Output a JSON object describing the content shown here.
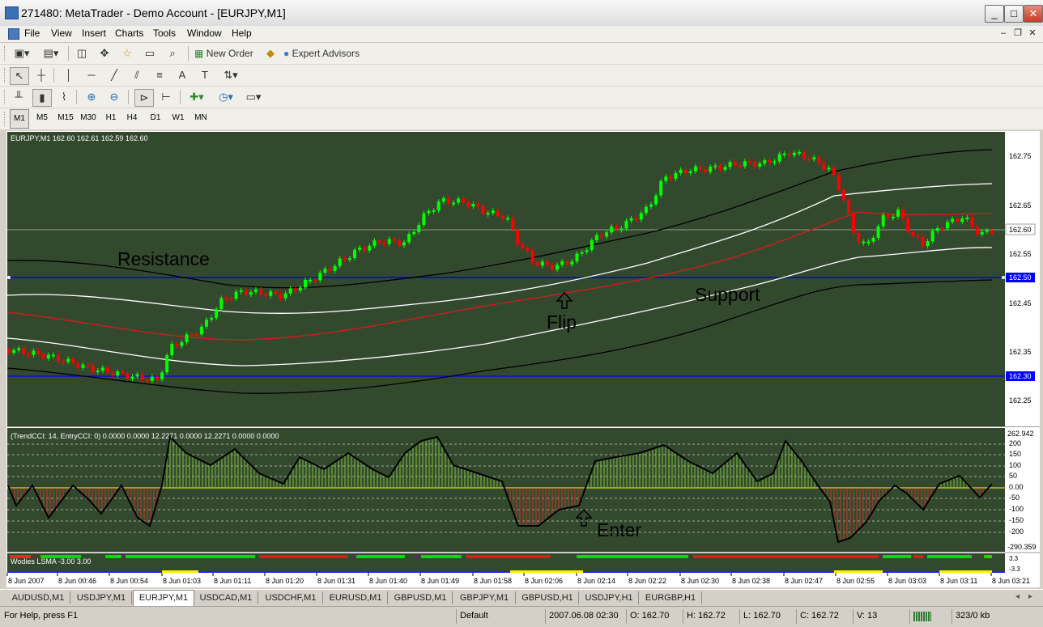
{
  "window": {
    "title": "271480: MetaTrader - Demo Account - [EURJPY,M1]"
  },
  "menu": [
    "File",
    "View",
    "Insert",
    "Charts",
    "Tools",
    "Window",
    "Help"
  ],
  "toolbar": {
    "new_order": "New Order",
    "expert_advisors": "Expert Advisors"
  },
  "timeframes": [
    "M1",
    "M5",
    "M15",
    "M30",
    "H1",
    "H4",
    "D1",
    "W1",
    "MN"
  ],
  "chart": {
    "header": "EURJPY,M1  162.60 162.61 162.59 162.60",
    "price_ticks": [
      "162.75",
      "162.65",
      "162.60",
      "162.55",
      "162.50",
      "162.45",
      "162.35",
      "162.30",
      "162.25"
    ],
    "annotations": {
      "resistance": "Resistance",
      "support": "Support",
      "flip": "Flip",
      "enter": "Enter"
    },
    "cci_header": "(TrendCCI: 14, EntryCCI: 0)  0.0000 0.0000 12.2271 0.0000 12.2271 0.0000 0.0000",
    "cci_ticks": [
      "262.942",
      "200",
      "150",
      "100",
      "50",
      "0.00",
      "-50",
      "-100",
      "-150",
      "-200",
      "-290.359"
    ],
    "lsma_header": "Wodies LSMA -3.00 3.00",
    "lsma_ticks": [
      "3.3",
      "-3.3"
    ],
    "time_ticks": [
      "8 Jun 2007",
      "8 Jun 00:46",
      "8 Jun 00:54",
      "8 Jun 01:03",
      "8 Jun 01:11",
      "8 Jun 01:20",
      "8 Jun 01:31",
      "8 Jun 01:40",
      "8 Jun 01:49",
      "8 Jun 01:58",
      "8 Jun 02:06",
      "8 Jun 02:14",
      "8 Jun 02:22",
      "8 Jun 02:30",
      "8 Jun 02:38",
      "8 Jun 02:47",
      "8 Jun 02:55",
      "8 Jun 03:03",
      "8 Jun 03:11",
      "8 Jun 03:21"
    ],
    "colors": {
      "background": "#33492e",
      "bull": "#00ff00",
      "bear": "#ff0000",
      "level_line": "#0000ff",
      "ma": "#cc1a1a",
      "band_inner": "#ffffff",
      "band_outer": "#000000"
    }
  },
  "symbol_tabs": [
    "AUDUSD,M1",
    "USDJPY,M1",
    "EURJPY,M1",
    "USDCAD,M1",
    "USDCHF,M1",
    "EURUSD,M1",
    "GBPUSD,M1",
    "GBPJPY,M1",
    "GBPUSD,H1",
    "USDJPY,H1",
    "EURGBP,H1"
  ],
  "active_tab": "EURJPY,M1",
  "status": {
    "help": "For Help, press F1",
    "profile": "Default",
    "datetime": "2007.06.08 02:30",
    "open": "O: 162.70",
    "high": "H: 162.72",
    "low": "L: 162.70",
    "close": "C: 162.72",
    "volume": "V: 13",
    "traffic": "323/0 kb"
  }
}
